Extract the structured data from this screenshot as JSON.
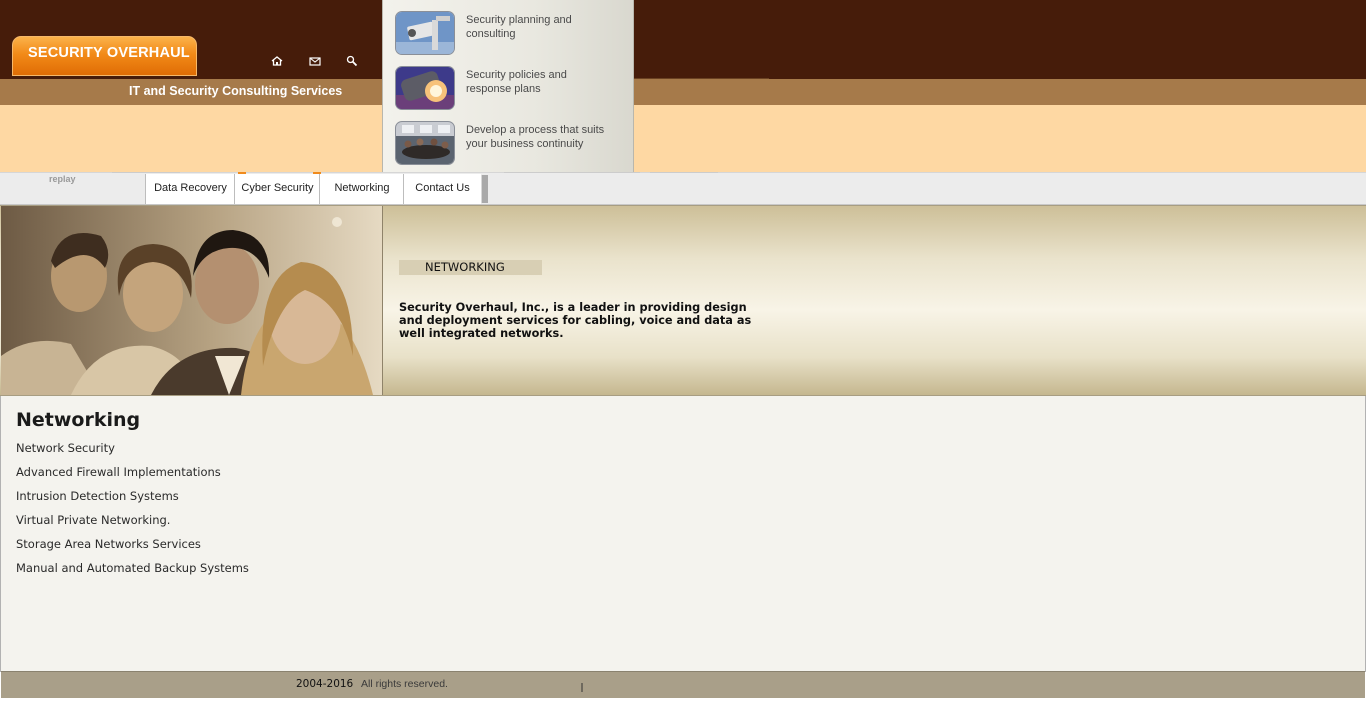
{
  "header": {
    "logo_text": "SECURITY OVERHAUL",
    "tagline": "IT and Security Consulting Services",
    "icons": [
      "home-icon",
      "mail-icon",
      "search-icon"
    ]
  },
  "dropdown": {
    "items": [
      {
        "line1": "Security planning and",
        "line2": "consulting",
        "thumb": "security-camera"
      },
      {
        "line1": "Security policies and",
        "line2": "response plans",
        "thumb": "spotlight"
      },
      {
        "line1": "Develop a process that suits",
        "line2": "your business continuity",
        "thumb": "meeting-room"
      }
    ]
  },
  "nav": {
    "replay_label": "replay",
    "items": [
      "Data Recovery",
      "Cyber Security",
      "Networking",
      "Contact Us"
    ]
  },
  "hero": {
    "section_label": "NETWORKING",
    "description": "Security Overhaul, Inc., is a leader in providing design and deployment services for cabling, voice and data as well integrated networks."
  },
  "content": {
    "title": "Networking",
    "services": [
      "Network Security",
      "Advanced Firewall Implementations",
      "Intrusion Detection Systems",
      "Virtual Private Networking.",
      "Storage Area Networks Services",
      "Manual and Automated Backup Systems"
    ]
  },
  "footer": {
    "years": "2004-2016",
    "rights": "All rights reserved."
  },
  "colors": {
    "header_dark": "#461c0a",
    "band_tan": "#a67a4a",
    "band_peach": "#fed8a3",
    "logo_orange": "#f28a18",
    "footer_tan": "#a99f89"
  }
}
